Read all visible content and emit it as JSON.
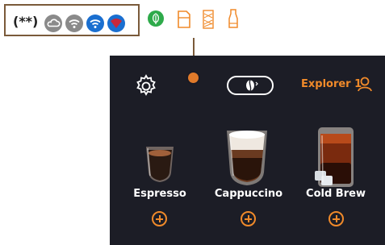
{
  "status_bar": {
    "note_label": "(**)",
    "icons": [
      "cloud-icon",
      "wifi-weak-icon",
      "wifi-connected-icon",
      "wifi-alert-icon"
    ],
    "extra_icons": [
      "eco-icon",
      "water-tank-icon",
      "filter-icon",
      "milk-carafe-icon"
    ]
  },
  "toolbar": {
    "settings_icon": "gear-icon",
    "bean_icon": "coffee-bean-icon",
    "profile_label": "Explorer 1",
    "profile_icon": "user-icon"
  },
  "beverages": [
    {
      "label": "Espresso",
      "icon": "espresso-cup-icon"
    },
    {
      "label": "Cappuccino",
      "icon": "cappuccino-cup-icon"
    },
    {
      "label": "Cold Brew",
      "icon": "cold-brew-glass-icon"
    }
  ],
  "colors": {
    "accent": "#f08a2a",
    "panel": "#1c1d26",
    "status_grey": "#8a8a8a",
    "status_blue": "#1a6fd0",
    "status_red": "#c8283a",
    "eco_green": "#2eaa4a"
  }
}
